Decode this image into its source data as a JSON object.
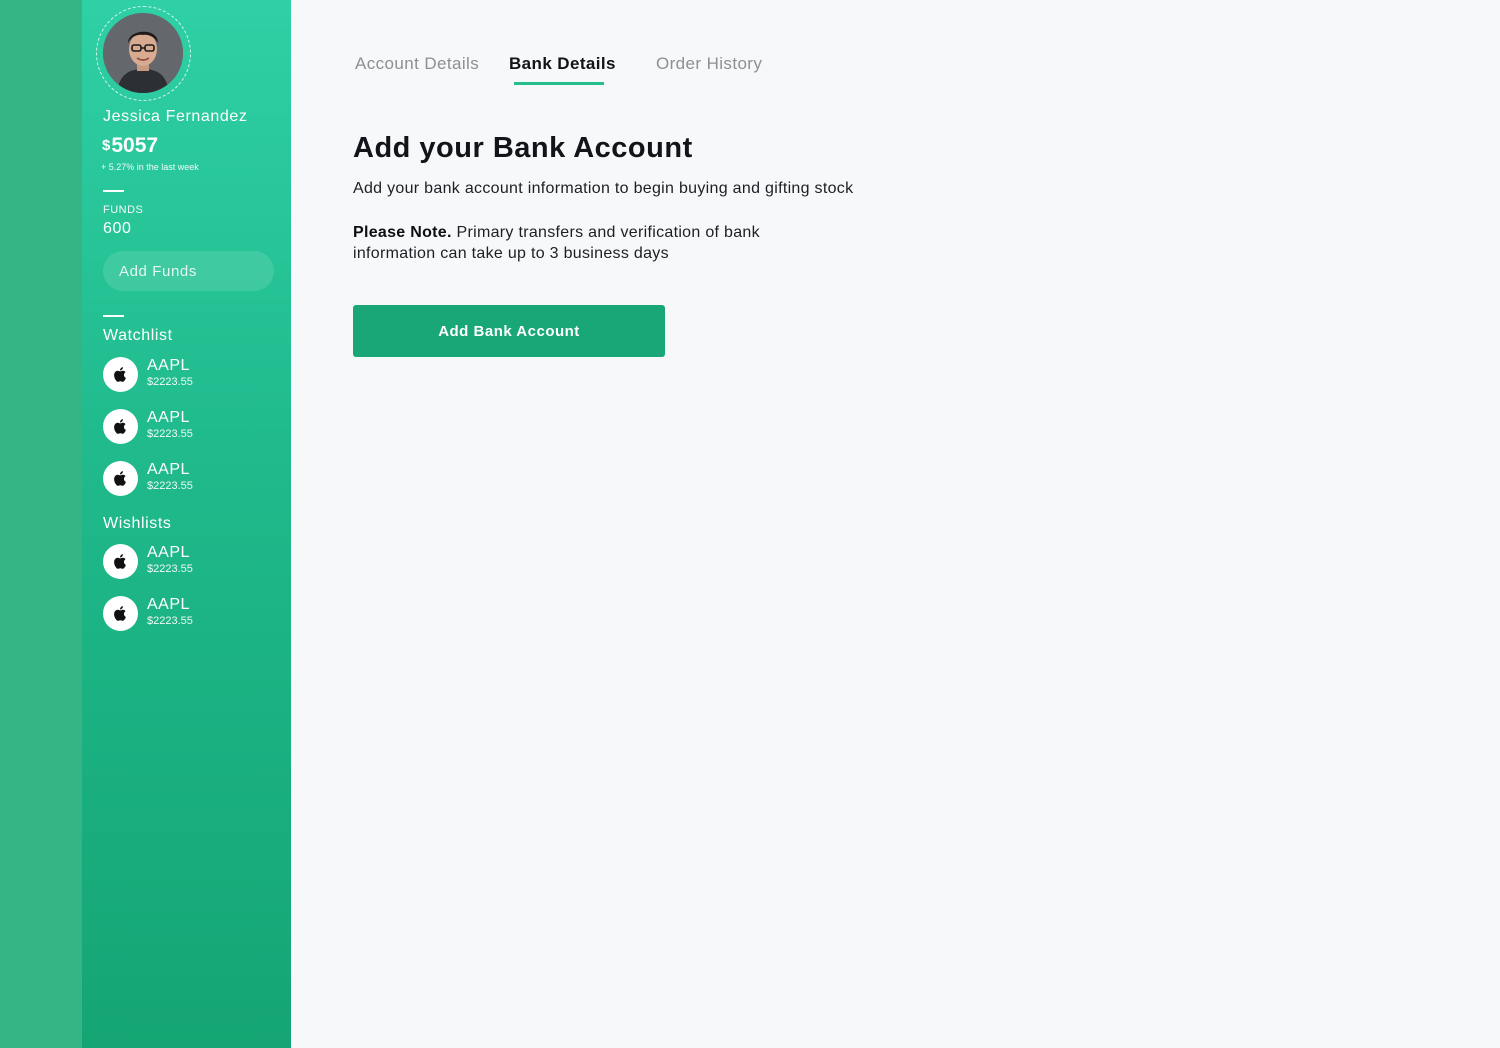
{
  "user": {
    "name": "Jessica Fernandez",
    "currency_symbol": "$",
    "balance": "5057",
    "change_text": "+ 5.27% in the last week",
    "funds_label": "FUNDS",
    "funds_value": "600",
    "add_funds_label": "Add Funds"
  },
  "watchlist": {
    "title": "Watchlist",
    "items": [
      {
        "ticker": "AAPL",
        "price": "$2223.55",
        "icon": "apple-logo-icon"
      },
      {
        "ticker": "AAPL",
        "price": "$2223.55",
        "icon": "apple-logo-icon"
      },
      {
        "ticker": "AAPL",
        "price": "$2223.55",
        "icon": "apple-logo-icon"
      }
    ]
  },
  "wishlists": {
    "title": "Wishlists",
    "items": [
      {
        "ticker": "AAPL",
        "price": "$2223.55",
        "icon": "apple-logo-icon"
      },
      {
        "ticker": "AAPL",
        "price": "$2223.55",
        "icon": "apple-logo-icon"
      }
    ]
  },
  "tabs": [
    {
      "label": "Account Details",
      "active": false
    },
    {
      "label": "Bank Details",
      "active": true
    },
    {
      "label": "Order History",
      "active": false
    }
  ],
  "main": {
    "title": "Add your Bank Account",
    "subtitle": "Add your bank account information to begin buying and gifting stock",
    "note_bold": "Please Note.",
    "note_text": " Primary transfers and verification of bank information can take up to 3 business days",
    "button_label": "Add Bank Account"
  },
  "colors": {
    "accent": "#25bf8d",
    "button": "#19a778",
    "rail": "#35b585",
    "sidebar_top": "#2fd0a5",
    "sidebar_bottom": "#15a574"
  }
}
